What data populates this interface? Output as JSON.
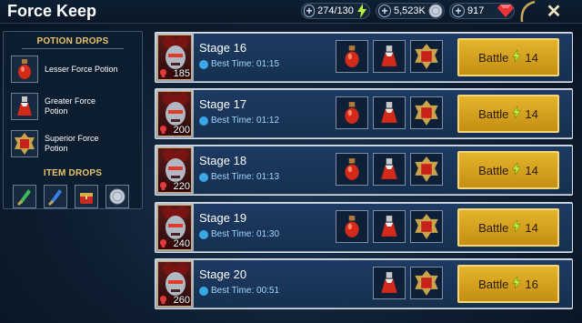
{
  "header": {
    "title": "Force Keep",
    "energy": "274/130",
    "silver": "5,523K",
    "gems": "917",
    "close_glyph": "✕"
  },
  "sidebar": {
    "potion_drops_title": "POTION DROPS",
    "potions": [
      {
        "label": "Lesser Force Potion",
        "icon": "lesser-force-potion-icon"
      },
      {
        "label": "Greater Force Potion",
        "icon": "greater-force-potion-icon"
      },
      {
        "label": "Superior Force Potion",
        "icon": "superior-force-potion-icon"
      }
    ],
    "item_drops_title": "ITEM DROPS",
    "items": [
      "green-artifact-icon",
      "blue-artifact-icon",
      "chest-icon",
      "silver-coin-icon"
    ]
  },
  "stages": [
    {
      "name": "Stage 16",
      "best_label": "Best Time:",
      "best_time": "01:15",
      "level": "185",
      "battle_label": "Battle",
      "energy_cost": "14",
      "drops": 3
    },
    {
      "name": "Stage 17",
      "best_label": "Best Time:",
      "best_time": "01:12",
      "level": "200",
      "battle_label": "Battle",
      "energy_cost": "14",
      "drops": 3
    },
    {
      "name": "Stage 18",
      "best_label": "Best Time:",
      "best_time": "01:13",
      "level": "220",
      "battle_label": "Battle",
      "energy_cost": "14",
      "drops": 3
    },
    {
      "name": "Stage 19",
      "best_label": "Best Time:",
      "best_time": "01:30",
      "level": "240",
      "battle_label": "Battle",
      "energy_cost": "14",
      "drops": 3
    },
    {
      "name": "Stage 20",
      "best_label": "Best Time:",
      "best_time": "00:51",
      "level": "260",
      "battle_label": "Battle",
      "energy_cost": "16",
      "drops": 2
    }
  ],
  "colors": {
    "battle_button": "#d9a520",
    "row_panel": "#1d3a63",
    "accent_gold": "#e8c46a"
  }
}
